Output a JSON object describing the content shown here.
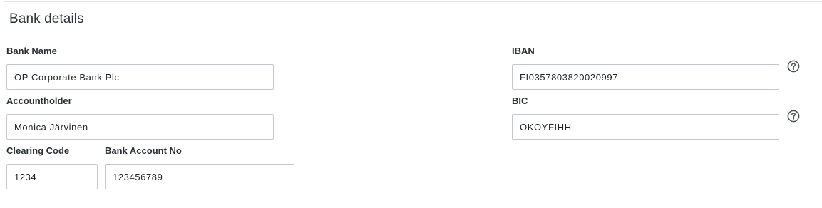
{
  "section": {
    "title": "Bank details"
  },
  "fields": {
    "bank_name": {
      "label": "Bank Name",
      "value": "OP Corporate Bank Plc"
    },
    "accountholder": {
      "label": "Accountholder",
      "value": "Monica Järvinen"
    },
    "clearing_code": {
      "label": "Clearing Code",
      "value": "1234"
    },
    "bank_account_no": {
      "label": "Bank Account No",
      "value": "123456789"
    },
    "iban": {
      "label": "IBAN",
      "value": "FI0357803820020997",
      "help_icon": "question-circle-icon"
    },
    "bic": {
      "label": "BIC",
      "value": "OKOYFIHH",
      "help_icon": "question-circle-icon"
    }
  },
  "colors": {
    "border": "#c4c8cc",
    "divider": "#e4e6e8",
    "text": "#2b2f33",
    "icon": "#4a4f54"
  }
}
